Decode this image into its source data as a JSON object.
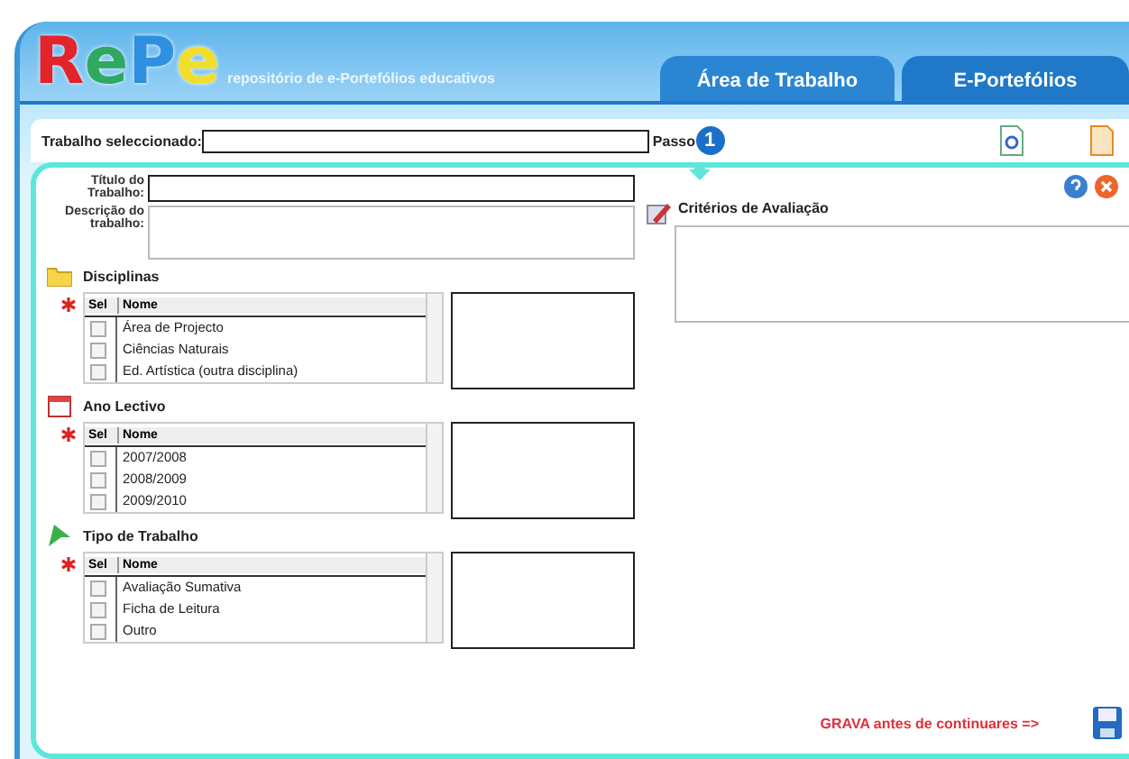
{
  "logo": {
    "letters": [
      {
        "text": "R",
        "color": "#e3242b"
      },
      {
        "text": "e",
        "color": "#2fa860"
      },
      {
        "text": "P",
        "color": "#2f8fe0"
      },
      {
        "text": "e",
        "color": "#f2dd2a"
      }
    ],
    "tagline": "repositório de e-Portefólios educativos"
  },
  "tabs": [
    {
      "label": "Área de Trabalho",
      "selected": true
    },
    {
      "label": "E-Portefólios",
      "selected": false
    }
  ],
  "selected_work": {
    "label": "Trabalho seleccionado:",
    "step_label": "Passo",
    "step": "1"
  },
  "title_field": {
    "label": "Título do Trabalho:"
  },
  "description_field": {
    "label": "Descrição do trabalho:"
  },
  "criteria": {
    "label": "Critérios de Avaliação"
  },
  "lists": [
    {
      "kind": "folder",
      "title": "Disciplinas",
      "columns": [
        "Sel",
        "Nome"
      ],
      "rows": [
        {
          "name": "Área de Projecto",
          "checked": false
        },
        {
          "name": "Ciências Naturais",
          "checked": false
        },
        {
          "name": "Ed. Artística (outra disciplina)",
          "checked": false
        }
      ]
    },
    {
      "kind": "calendar",
      "title": "Ano Lectivo",
      "columns": [
        "Sel",
        "Nome"
      ],
      "rows": [
        {
          "name": "2007/2008",
          "checked": false
        },
        {
          "name": "2008/2009",
          "checked": false
        },
        {
          "name": "2009/2010",
          "checked": false
        }
      ]
    },
    {
      "kind": "arrow",
      "title": "Tipo de Trabalho",
      "columns": [
        "Sel",
        "Nome"
      ],
      "rows": [
        {
          "name": "Avaliação Sumativa",
          "checked": false
        },
        {
          "name": "Ficha de Leitura",
          "checked": false
        },
        {
          "name": "Outro",
          "checked": false
        }
      ]
    }
  ],
  "save_hint": "GRAVA antes de continuares =>"
}
